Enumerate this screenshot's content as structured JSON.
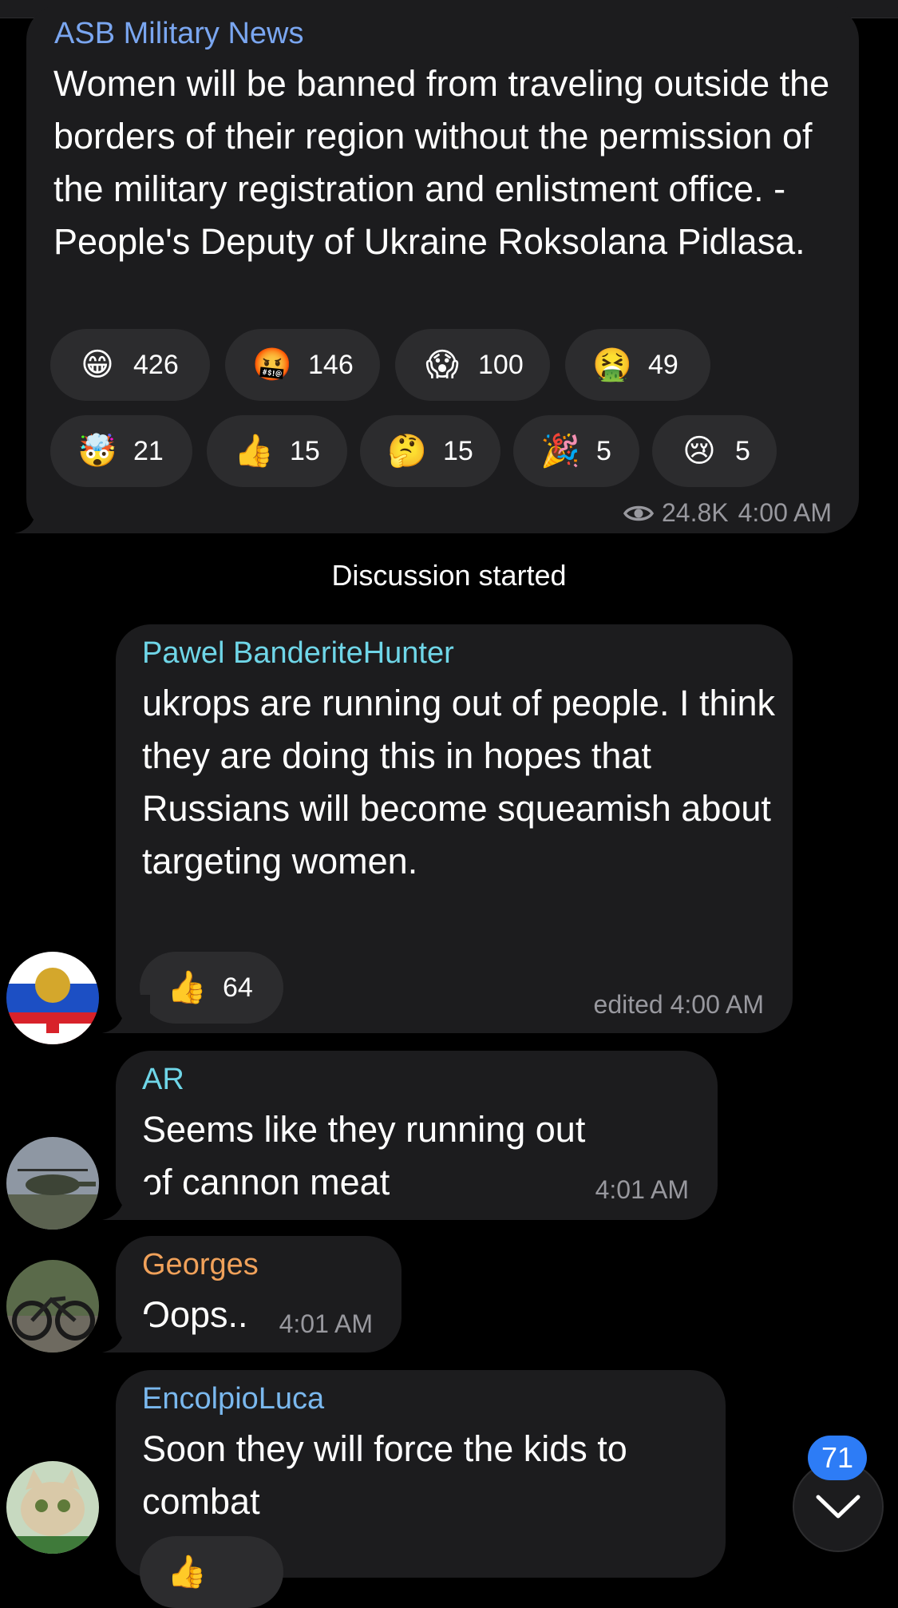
{
  "channel_post": {
    "author": "ASB Military News",
    "text": "Women will be banned from traveling outside the borders of their region without the permission of the military registration and enlistment office. - People's Deputy of Ukraine Roksolana Pidlasa.",
    "reactions_row1": [
      {
        "emoji": "😁",
        "icon": "grinning-face-icon",
        "count": "426"
      },
      {
        "emoji": "🤬",
        "icon": "cursing-face-icon",
        "count": "146"
      },
      {
        "emoji": "😱",
        "icon": "screaming-face-icon",
        "count": "100"
      },
      {
        "emoji": "🤮",
        "icon": "vomiting-face-icon",
        "count": "49"
      }
    ],
    "reactions_row2": [
      {
        "emoji": "🤯",
        "icon": "exploding-head-icon",
        "count": "21"
      },
      {
        "emoji": "👍",
        "icon": "thumbs-up-icon",
        "count": "15"
      },
      {
        "emoji": "🤔",
        "icon": "thinking-face-icon",
        "count": "15"
      },
      {
        "emoji": "🎉",
        "icon": "party-popper-icon",
        "count": "5"
      },
      {
        "emoji": "😢",
        "icon": "crying-face-icon",
        "count": "5"
      }
    ],
    "views": "24.8K",
    "time": "4:00 AM"
  },
  "system_message": "Discussion started",
  "comments": [
    {
      "author": "Pawel BanderiteHunter",
      "author_color": "#6fd6e8",
      "text": "ukrops are running out of people. I think they are doing this in hopes that Russians will become squeamish about targeting women.",
      "reaction": {
        "emoji": "👍",
        "icon": "thumbs-up-icon",
        "count": "64"
      },
      "meta": "edited 4:00 AM"
    },
    {
      "author": "AR",
      "author_color": "#6fd6e8",
      "text": "Seems like they running out of cannon meat",
      "meta": "4:01 AM"
    },
    {
      "author": "Georges",
      "author_color": "#f0a15a",
      "text": "Oops..",
      "meta": "4:01 AM"
    },
    {
      "author": "EncolpioLuca",
      "author_color": "#7ab8ee",
      "text": "Soon they will force the kids to combat",
      "reaction": {
        "emoji": "👍",
        "icon": "thumbs-up-icon"
      }
    }
  ],
  "scroll_down": {
    "unread_count": "71"
  },
  "colors": {
    "background": "#000000",
    "bubble": "#1c1c1e",
    "reaction_pill": "#2c2c2e",
    "channel_name": "#7aa6f0",
    "meta_text": "#98989e",
    "unread_badge": "#2d7cf6"
  }
}
